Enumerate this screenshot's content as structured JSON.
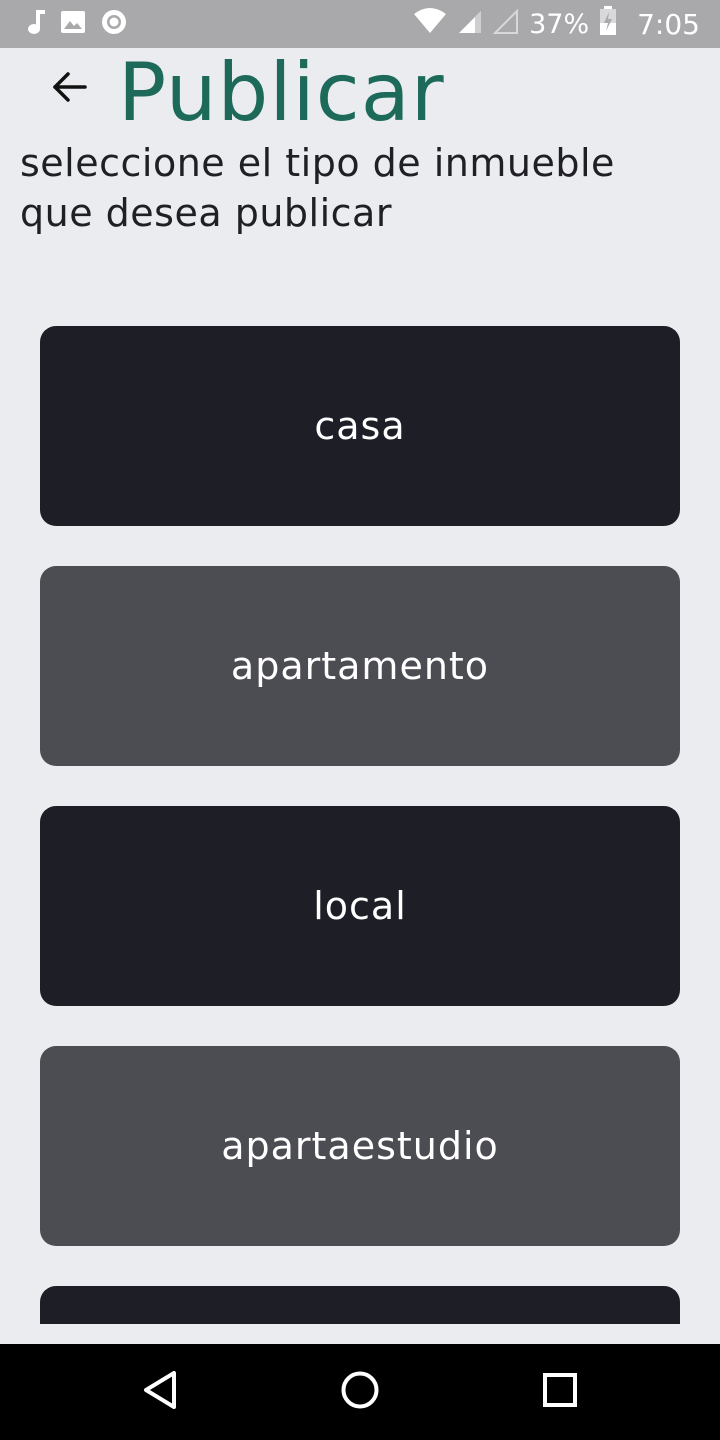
{
  "status_bar": {
    "battery_percent": "37%",
    "time": "7:05",
    "icons": [
      "music-note-icon",
      "image-icon",
      "record-icon",
      "wifi-icon",
      "signal-icon",
      "signal-empty-icon",
      "battery-charging-icon"
    ]
  },
  "header": {
    "title": "Publicar",
    "back_icon": "arrow-left-icon"
  },
  "subtitle": "seleccione el tipo de inmueble que desea publicar",
  "options": [
    {
      "label": "casa",
      "style": "dark"
    },
    {
      "label": "apartamento",
      "style": "gray"
    },
    {
      "label": "local",
      "style": "dark"
    },
    {
      "label": "apartaestudio",
      "style": "gray"
    },
    {
      "label": "",
      "style": "dark"
    }
  ],
  "nav_bar": {
    "icons": [
      "back-triangle-icon",
      "home-circle-icon",
      "recents-square-icon"
    ]
  },
  "colors": {
    "title": "#1e6a5a",
    "background": "#ebecf0",
    "button_dark": "#1e1e27",
    "button_gray": "#4c4c53",
    "status_bar": "#a9a9ab"
  }
}
